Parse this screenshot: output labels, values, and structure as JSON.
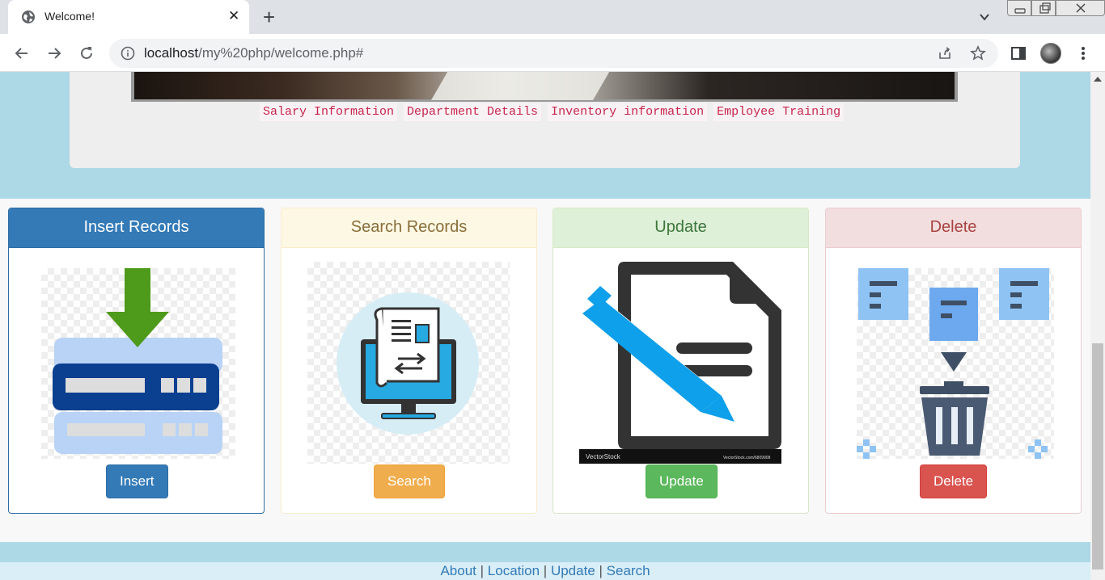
{
  "browser": {
    "tab_title": "Welcome!",
    "url_host": "localhost",
    "url_path": "/my%20php/welcome.php#"
  },
  "hero": {
    "links": [
      "Salary Information",
      "Department Details",
      "Inventory information",
      "Employee Training"
    ]
  },
  "panels": [
    {
      "title": "Insert Records",
      "button": "Insert",
      "image": "database-insert-icon"
    },
    {
      "title": "Search Records",
      "button": "Search",
      "image": "computer-document-icon"
    },
    {
      "title": "Update",
      "button": "Update",
      "image": "document-edit-icon",
      "watermark_left": "VectorStock",
      "watermark_right": "VectorStock.com/6809908"
    },
    {
      "title": "Delete",
      "button": "Delete",
      "image": "trash-notes-icon"
    }
  ],
  "footer": {
    "links": [
      "About",
      "Location",
      "Update",
      "Search"
    ],
    "separator": "|"
  },
  "colors": {
    "primary": "#337ab7",
    "warning": "#f0ad4e",
    "success": "#5cb85c",
    "danger": "#d9534f",
    "page_bg": "#add8e6",
    "code_text": "#c7254e"
  }
}
